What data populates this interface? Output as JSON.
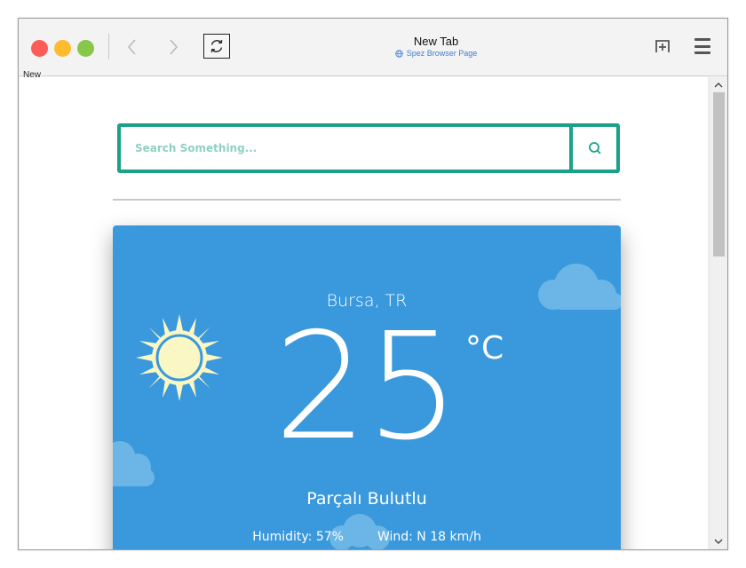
{
  "browser": {
    "tab_title": "New Tab",
    "tab_subtitle": "Spez Browser Page",
    "new_label": "New"
  },
  "traffic_colors": {
    "close": "#fc5c57",
    "minimize": "#fdbc2e",
    "maximize": "#87c74a"
  },
  "icons": {
    "back": "chevron-left-icon",
    "forward": "chevron-right-icon",
    "reload": "reload-icon",
    "new_tab": "new-tab-icon",
    "menu": "hamburger-menu-icon",
    "globe": "globe-icon",
    "search": "search-icon",
    "scroll_up": "scroll-up-arrow-icon",
    "scroll_down": "scroll-down-arrow-icon",
    "sun": "sun-icon",
    "cloud": "cloud-icon"
  },
  "search": {
    "placeholder": "Search Something..."
  },
  "weather": {
    "city": "Bursa, TR",
    "temperature": "25",
    "unit": "°C",
    "condition": "Parçalı Bulutlu",
    "humidity_text": "Humidity: 57%",
    "wind_text": "Wind: N 18 km/h"
  },
  "colors": {
    "accent": "#1aa187",
    "card": "#3a98dc",
    "sun": "#fbf7c4",
    "cloud": "#6bb6e6"
  }
}
